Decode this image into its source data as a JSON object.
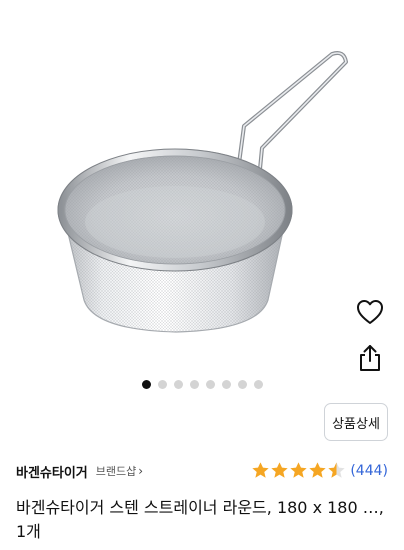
{
  "product": {
    "title": "바겐슈타이거 스텐 스트레이너 라운드, 180 x 180 …, 1개",
    "brand": "바겐슈타이거",
    "brand_shop_label": "브랜드샵",
    "rating": 4.5,
    "review_count": "(444)"
  },
  "gallery": {
    "total_images": 8,
    "active_index": 0
  },
  "actions": {
    "detail_label": "상품상세",
    "wishlist_icon": "heart-icon",
    "share_icon": "share-icon"
  },
  "colors": {
    "star": "#f5a623",
    "review_link": "#3466d8",
    "dot_active": "#111111",
    "dot_inactive": "#d4d4d4"
  }
}
